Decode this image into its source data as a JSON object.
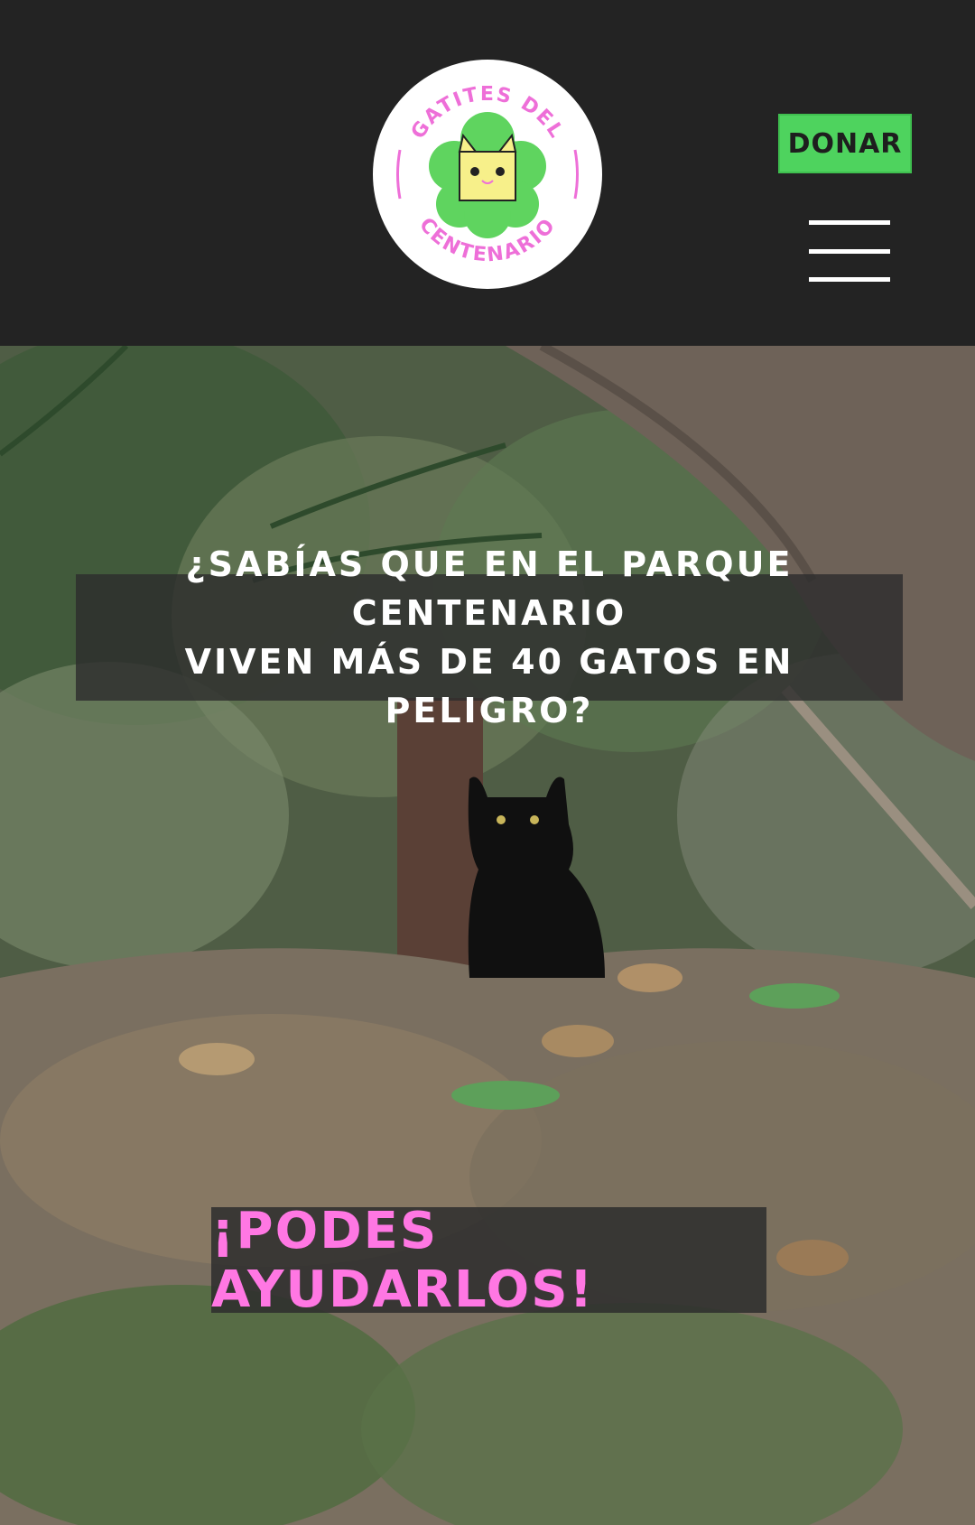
{
  "header": {
    "logo": {
      "top_text": "GATITES DEL",
      "bottom_text": "CENTENARIO",
      "colors": {
        "ring_text": "#ee6fd8",
        "cloud": "#5fd45f",
        "cat": "#f7f08a"
      }
    },
    "donate_label": "DONAR",
    "menu_icon": "hamburger-menu-icon",
    "colors": {
      "background": "#232323",
      "donate": "#4ed35e"
    }
  },
  "hero": {
    "image": "black-cat-in-park-photo",
    "question": "¿SABÍAS QUE EN EL PARQUE CENTENARIO\nVIVEN MÁS DE 40 GATOS EN PELIGRO?",
    "cta": "¡PODES AYUDARLOS!",
    "colors": {
      "cta_text": "#ff77e3",
      "overlay": "#2d2d2d"
    }
  }
}
